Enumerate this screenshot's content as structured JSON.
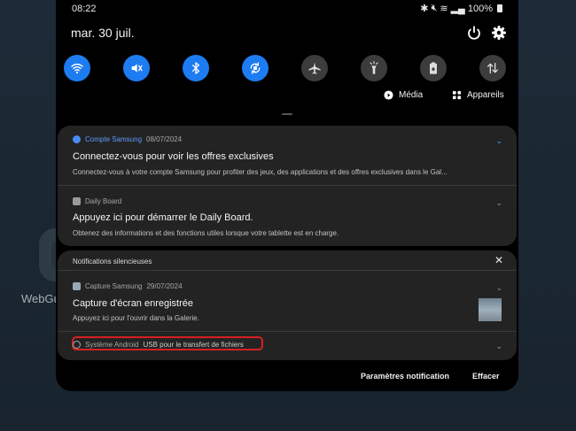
{
  "status_bar": {
    "time": "08:22",
    "battery": "100%"
  },
  "header": {
    "date": "mar. 30 juil."
  },
  "quick_settings": [
    {
      "name": "wifi",
      "on": true
    },
    {
      "name": "mute",
      "on": true
    },
    {
      "name": "bluetooth",
      "on": true
    },
    {
      "name": "auto-rotate",
      "on": true
    },
    {
      "name": "airplane",
      "on": false
    },
    {
      "name": "flashlight",
      "on": false
    },
    {
      "name": "power-saving",
      "on": false
    },
    {
      "name": "data-transfer",
      "on": false
    }
  ],
  "media_row": {
    "media_label": "Média",
    "devices_label": "Appareils"
  },
  "home": {
    "app_label": "WebGu"
  },
  "notifications": [
    {
      "app": "Compte Samsung",
      "date": "08/07/2024",
      "title": "Connectez-vous pour voir les offres exclusives",
      "body": "Connectez-vous à votre compte Samsung pour profiter des jeux, des applications et des offres exclusives dans le Gal..."
    },
    {
      "app": "Daily Board",
      "title": "Appuyez ici pour démarrer le Daily Board.",
      "body": "Obtenez des informations et des fonctions utiles lorsque votre tablette est en charge."
    }
  ],
  "silent": {
    "header": "Notifications silencieuses",
    "items": [
      {
        "app": "Capture Samsung",
        "date": "29/07/2024",
        "title": "Capture d'écran enregistrée",
        "body": "Appuyez ici pour l'ouvrir dans la Galerie."
      },
      {
        "app": "Système Android",
        "title": "USB pour le transfert de fichiers"
      }
    ]
  },
  "footer": {
    "settings_label": "Paramètres notification",
    "clear_label": "Effacer"
  },
  "colors": {
    "accent": "#1d7cf2",
    "panel": "#000000",
    "card": "#232323",
    "highlight": "#d42020"
  }
}
